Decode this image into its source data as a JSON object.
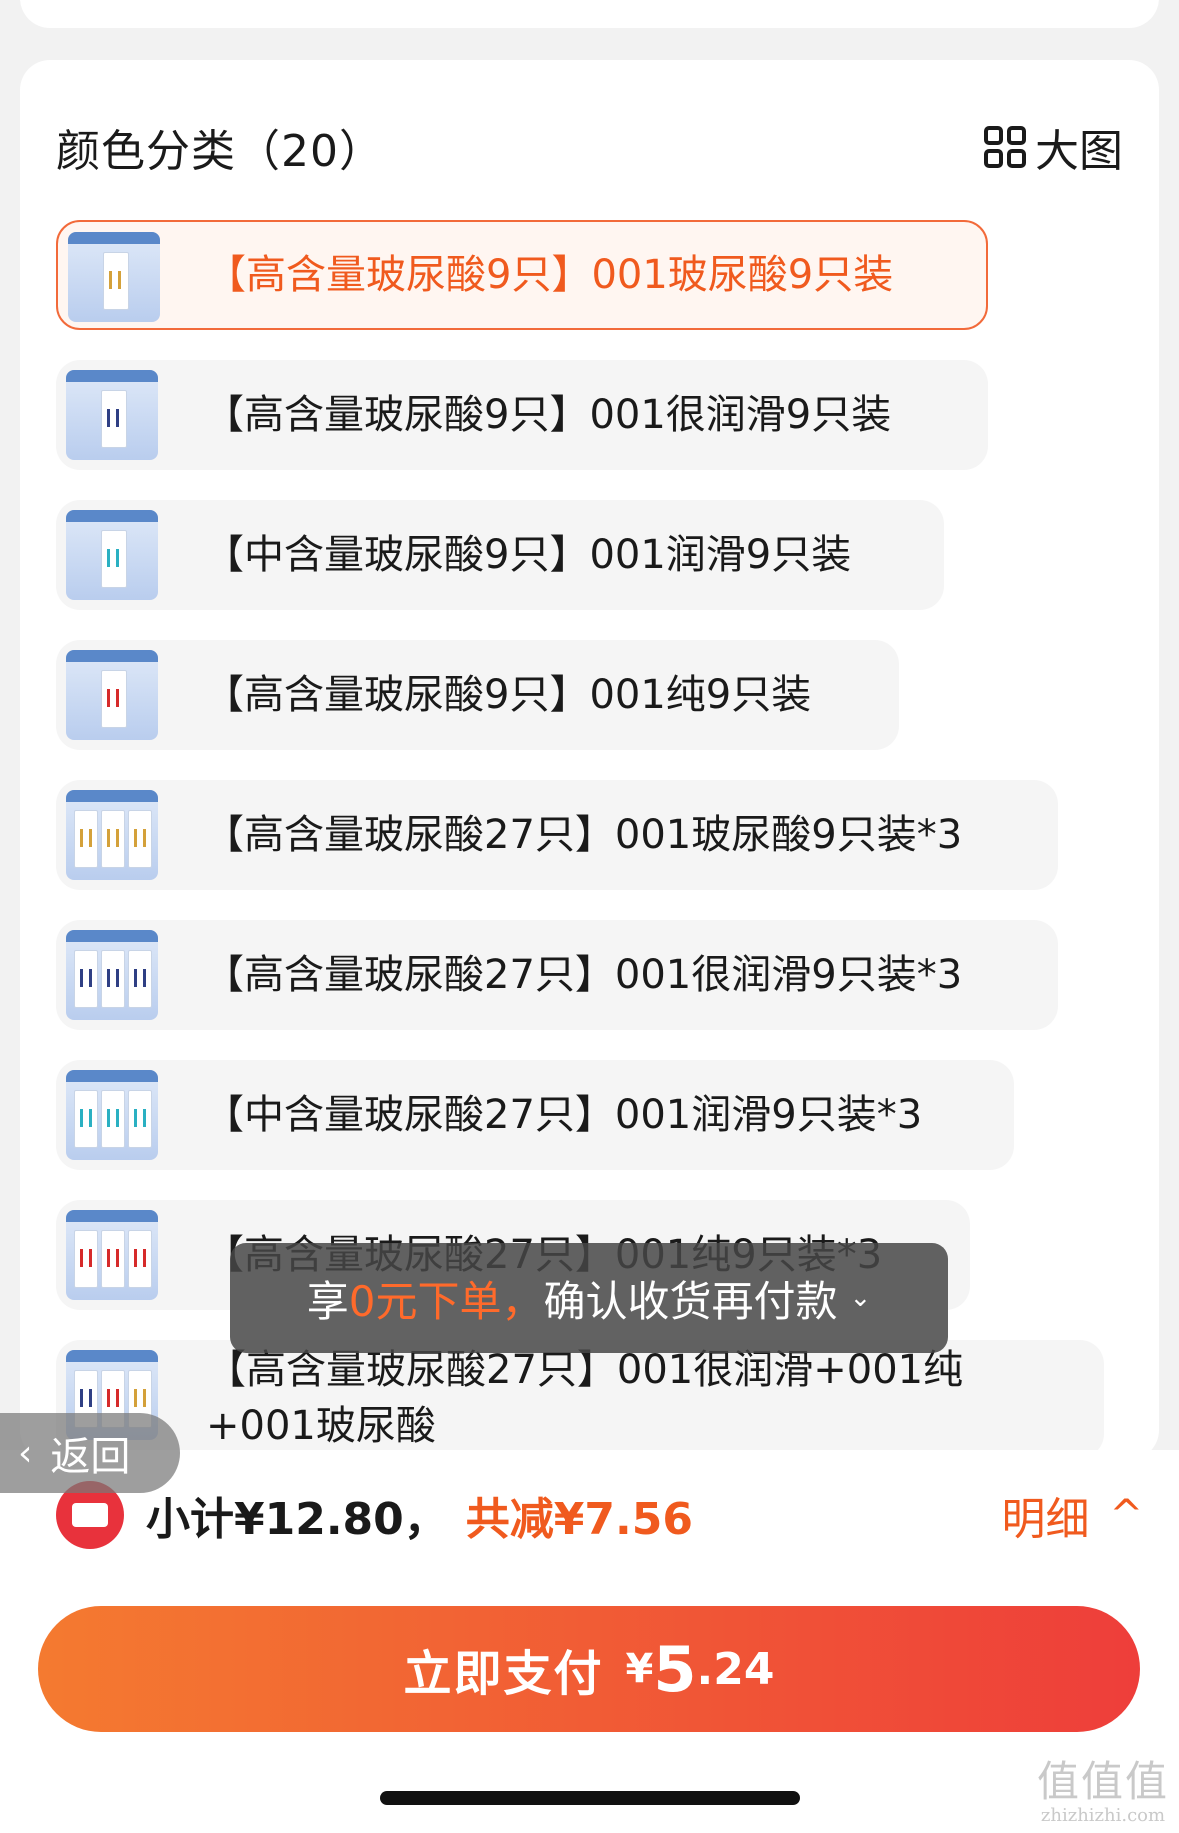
{
  "panel": {
    "title": "颜色分类（20）",
    "bigview_label": "大图"
  },
  "skus": [
    {
      "label": "【高含量玻尿酸9只】001玻尿酸9只装",
      "selected": true,
      "thumb": "single-gold"
    },
    {
      "label": "【高含量玻尿酸9只】001很润滑9只装",
      "selected": false,
      "thumb": "single-navy"
    },
    {
      "label": "【中含量玻尿酸9只】001润滑9只装",
      "selected": false,
      "thumb": "single-teal"
    },
    {
      "label": "【高含量玻尿酸9只】001纯9只装",
      "selected": false,
      "thumb": "single-red"
    },
    {
      "label": "【高含量玻尿酸27只】001玻尿酸9只装*3",
      "selected": false,
      "thumb": "triple-gold"
    },
    {
      "label": "【高含量玻尿酸27只】001很润滑9只装*3",
      "selected": false,
      "thumb": "triple-navy"
    },
    {
      "label": "【中含量玻尿酸27只】001润滑9只装*3",
      "selected": false,
      "thumb": "triple-teal"
    },
    {
      "label": "【高含量玻尿酸27只】001纯9只装*3",
      "selected": false,
      "thumb": "triple-red"
    },
    {
      "label": "【高含量玻尿酸27只】001很润滑+001纯+001玻尿酸",
      "selected": false,
      "thumb": "triple-mixed"
    }
  ],
  "toast": {
    "prefix": "享",
    "highlight": "0元下单，",
    "suffix": "确认收货再付款",
    "chevron": "⌄"
  },
  "back": {
    "label": "返回",
    "chevron": "‹"
  },
  "summary": {
    "subtotal": "小计¥12.80，",
    "saved": "共减¥7.56",
    "detail_label": "明细",
    "detail_caret": "^"
  },
  "pay": {
    "label": "立即支付",
    "currency": "¥",
    "amount_int": "5",
    "amount_dec": ".24"
  },
  "watermark": {
    "main": "值值值",
    "url": "zhizhizhi.com"
  },
  "colors": {
    "accent": "#f05a1e",
    "pay_start": "#f47a30",
    "pay_end": "#ee3e3a",
    "coupon": "#e8323c"
  }
}
